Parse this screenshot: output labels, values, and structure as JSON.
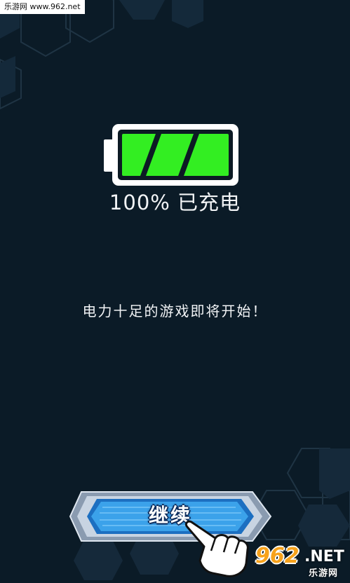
{
  "watermark": {
    "top_text": "乐游网 www.962.net",
    "logo_number": "962",
    "logo_suffix": ".NET",
    "logo_sub": "乐游网"
  },
  "battery": {
    "level_percent": 100,
    "fill_color": "#33ee22"
  },
  "status": {
    "charge_text": "100% 已充电"
  },
  "message": {
    "text": "电力十足的游戏即将开始！"
  },
  "continue_button": {
    "label": "继续"
  },
  "colors": {
    "background": "#0b1b27",
    "hex_pattern": "#1f3444",
    "button_blue": "#3a9fe6",
    "button_frame": "#b9c6d6"
  },
  "icons": {
    "battery": "battery-icon",
    "pointer": "hand-pointer-icon"
  }
}
